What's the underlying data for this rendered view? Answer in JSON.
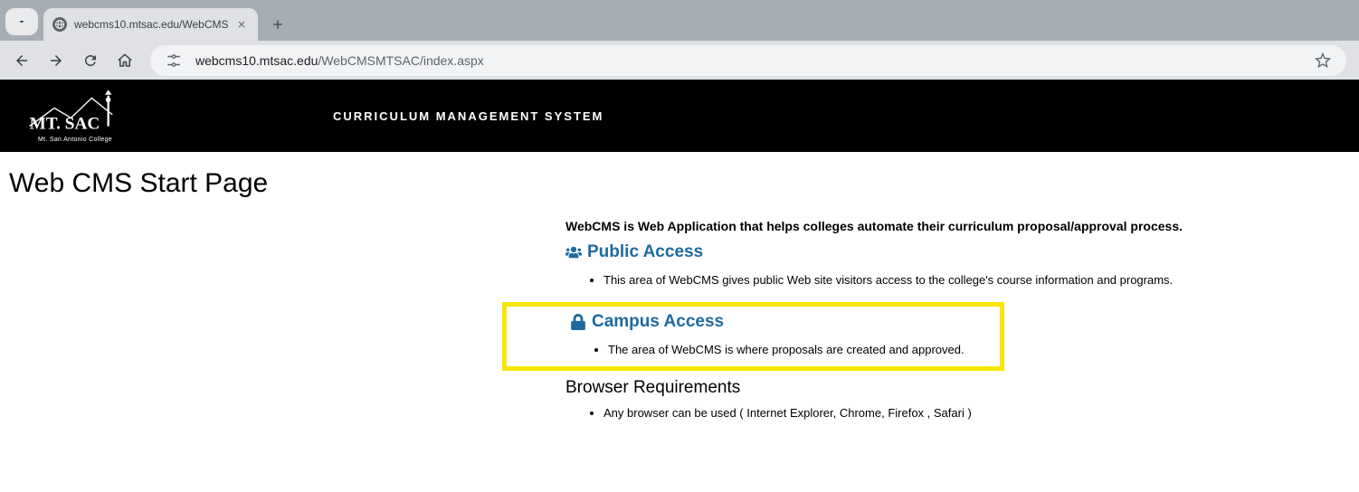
{
  "browser": {
    "tab_title": "webcms10.mtsac.edu/WebCMS",
    "url_domain": "webcms10.mtsac.edu",
    "url_path": "/WebCMSMTSAC/index.aspx"
  },
  "header": {
    "logo_main": "MT. SAC",
    "logo_sub": "Mt. San Antonio College",
    "title": "CURRICULUM MANAGEMENT SYSTEM"
  },
  "page": {
    "title": "Web CMS Start Page",
    "intro": "WebCMS is Web Application that helps colleges automate their curriculum proposal/approval process.",
    "sections": [
      {
        "heading": "Public Access",
        "bullet": "This area of WebCMS gives public Web site visitors access to the college's course information and programs."
      },
      {
        "heading": "Campus Access",
        "bullet": "The area of WebCMS is where proposals are created and approved."
      },
      {
        "heading": "Browser Requirements",
        "bullet": "Any browser can be used ( Internet Explorer, Chrome, Firefox , Safari )"
      }
    ]
  }
}
